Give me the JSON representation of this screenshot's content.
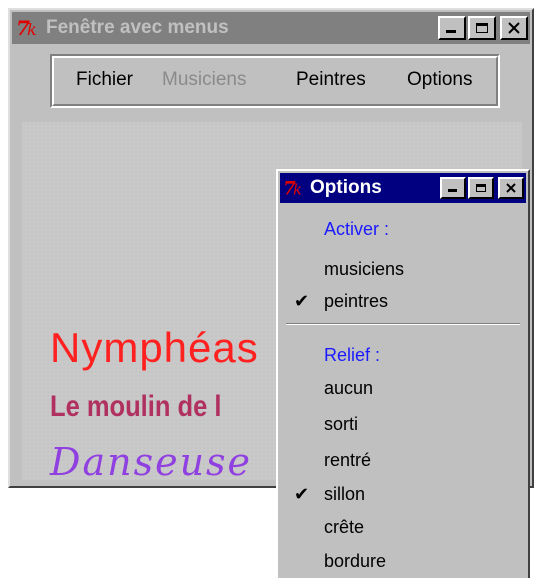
{
  "main_window": {
    "title": "Fenêtre avec menus",
    "menus": [
      {
        "label": "Fichier",
        "enabled": true
      },
      {
        "label": "Musiciens",
        "enabled": false
      },
      {
        "label": "Peintres",
        "enabled": true
      },
      {
        "label": "Options",
        "enabled": true
      }
    ],
    "canvas_lines": [
      "Nymphéas",
      "Le moulin de l",
      "Danseuse"
    ]
  },
  "options_window": {
    "title": "Options",
    "activate_label": "Activer :",
    "activate_items": [
      {
        "label": "musiciens",
        "checked": false
      },
      {
        "label": "peintres",
        "checked": true
      }
    ],
    "relief_label": "Relief :",
    "relief_items": [
      {
        "label": "aucun",
        "checked": false
      },
      {
        "label": "sorti",
        "checked": false
      },
      {
        "label": "rentré",
        "checked": false
      },
      {
        "label": "sillon",
        "checked": true
      },
      {
        "label": "crête",
        "checked": false
      },
      {
        "label": "bordure",
        "checked": false
      }
    ],
    "check_glyph": "✔"
  },
  "colors": {
    "line1": "#ff2020",
    "line2": "#b03060",
    "line3": "#9040e0",
    "section_label": "#1a1aff",
    "active_title": "#000080",
    "inactive_title": "#808080"
  }
}
